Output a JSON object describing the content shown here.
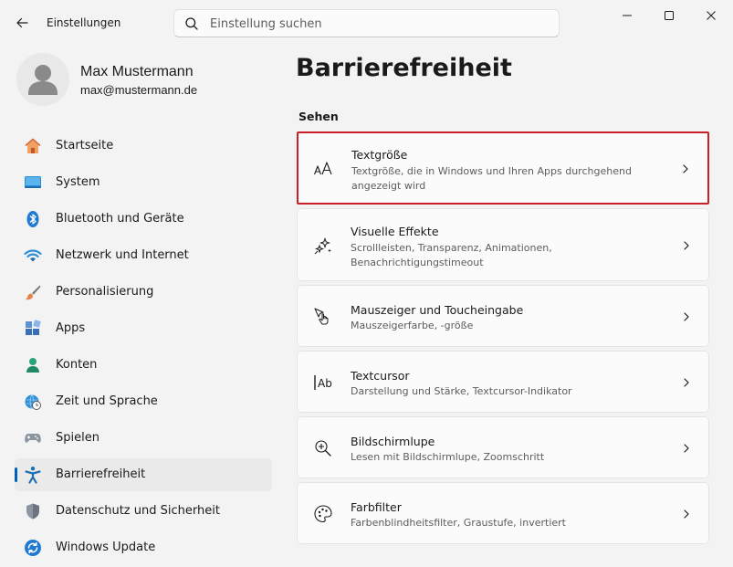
{
  "window": {
    "title": "Einstellungen"
  },
  "search": {
    "placeholder": "Einstellung suchen"
  },
  "profile": {
    "name": "Max Mustermann",
    "email": "max@mustermann.de"
  },
  "sidebar": {
    "items": [
      {
        "label": "Startseite",
        "icon": "home-icon"
      },
      {
        "label": "System",
        "icon": "display-icon"
      },
      {
        "label": "Bluetooth und Geräte",
        "icon": "bluetooth-icon"
      },
      {
        "label": "Netzwerk und Internet",
        "icon": "wifi-icon"
      },
      {
        "label": "Personalisierung",
        "icon": "brush-icon"
      },
      {
        "label": "Apps",
        "icon": "apps-icon"
      },
      {
        "label": "Konten",
        "icon": "person-icon"
      },
      {
        "label": "Zeit und Sprache",
        "icon": "globe-clock-icon"
      },
      {
        "label": "Spielen",
        "icon": "gamepad-icon"
      },
      {
        "label": "Barrierefreiheit",
        "icon": "accessibility-icon",
        "active": true
      },
      {
        "label": "Datenschutz und Sicherheit",
        "icon": "shield-icon"
      },
      {
        "label": "Windows Update",
        "icon": "update-icon"
      }
    ]
  },
  "main": {
    "title": "Barrierefreiheit",
    "section": "Sehen",
    "cards": [
      {
        "title": "Textgröße",
        "desc": "Textgröße, die in Windows und Ihren Apps durchgehend angezeigt wird",
        "icon": "text-size-icon"
      },
      {
        "title": "Visuelle Effekte",
        "desc": "Scrollleisten, Transparenz, Animationen, Benachrichtigungstimeout",
        "icon": "sparkle-icon"
      },
      {
        "title": "Mauszeiger und Toucheingabe",
        "desc": "Mauszeigerfarbe, -größe",
        "icon": "pointer-touch-icon"
      },
      {
        "title": "Textcursor",
        "desc": "Darstellung und Stärke, Textcursor-Indikator",
        "icon": "text-cursor-icon"
      },
      {
        "title": "Bildschirmlupe",
        "desc": "Lesen mit Bildschirmlupe, Zoomschritt",
        "icon": "magnifier-icon"
      },
      {
        "title": "Farbfilter",
        "desc": "Farbenblindheitsfilter, Graustufe, invertiert",
        "icon": "palette-icon"
      }
    ]
  },
  "colors": {
    "accent": "#005fb8",
    "highlight_border": "#c8202a"
  }
}
